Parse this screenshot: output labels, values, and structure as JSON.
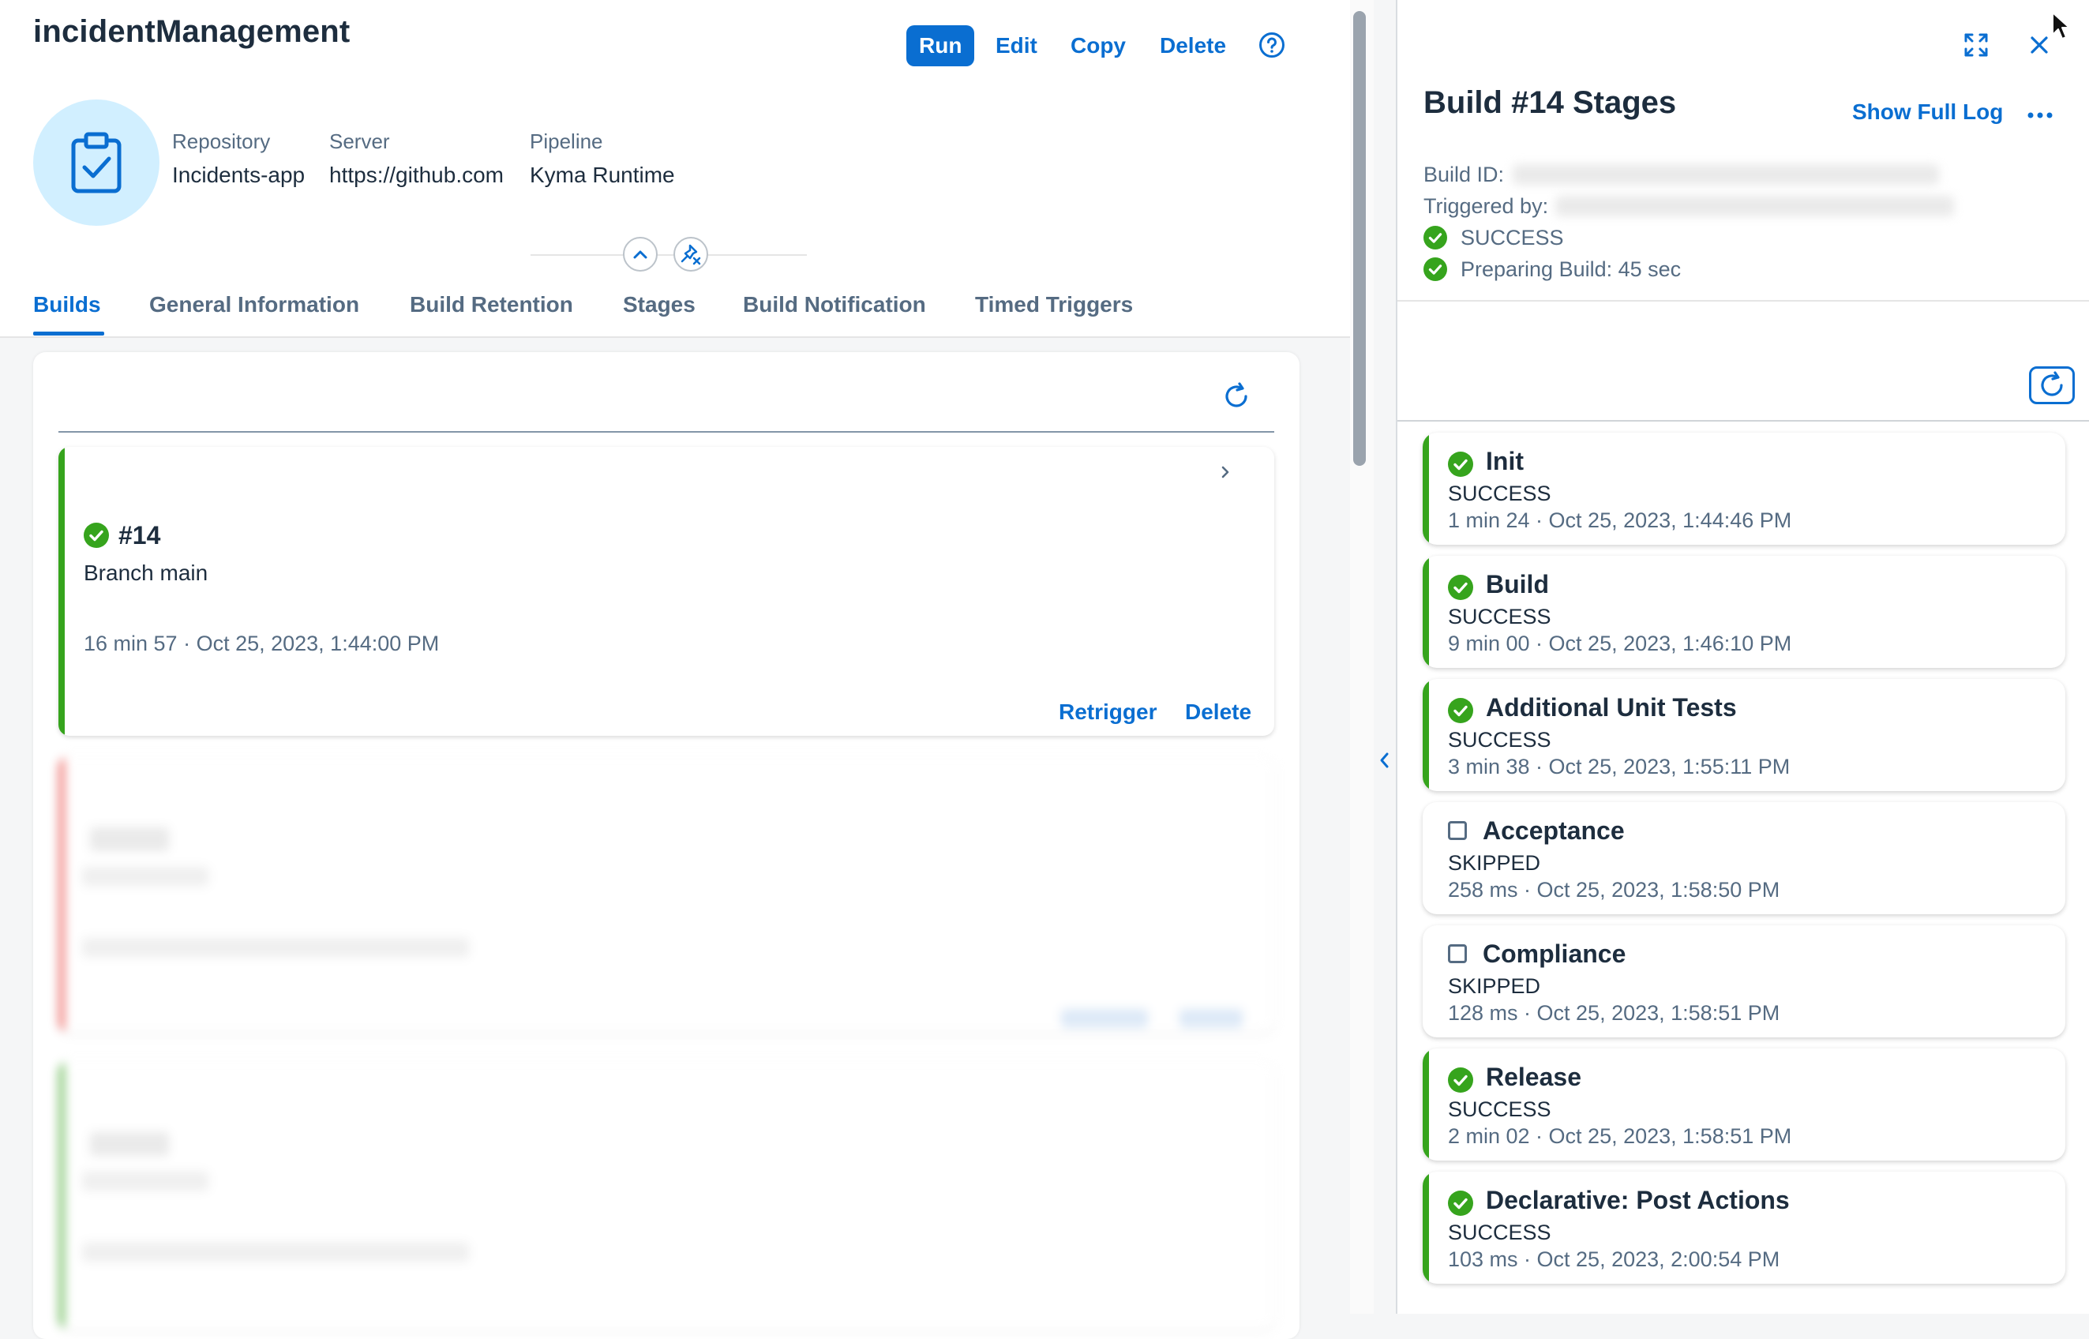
{
  "app": {
    "title": "incidentManagement"
  },
  "header_actions": {
    "run": "Run",
    "edit": "Edit",
    "copy": "Copy",
    "delete": "Delete"
  },
  "meta": {
    "repository_label": "Repository",
    "repository_value": "Incidents-app",
    "server_label": "Server",
    "server_value": "https://github.com",
    "pipeline_label": "Pipeline",
    "pipeline_value": "Kyma Runtime"
  },
  "tabs": [
    "Builds",
    "General Information",
    "Build Retention",
    "Stages",
    "Build Notification",
    "Timed Triggers"
  ],
  "build": {
    "number": "#14",
    "branch": "Branch main",
    "time": "16 min 57 · Oct 25, 2023, 1:44:00 PM",
    "retrigger": "Retrigger",
    "delete": "Delete"
  },
  "panel": {
    "title": "Build #14 Stages",
    "show_full_log": "Show Full Log",
    "build_id_label": "Build ID:",
    "triggered_by_label": "Triggered by:",
    "status": "SUCCESS",
    "preparing": "Preparing Build: 45 sec"
  },
  "stages": [
    {
      "name": "Init",
      "status": "SUCCESS",
      "time": "1 min 24 · Oct 25, 2023, 1:44:46 PM",
      "ok": true
    },
    {
      "name": "Build",
      "status": "SUCCESS",
      "time": "9 min 00 · Oct 25, 2023, 1:46:10 PM",
      "ok": true
    },
    {
      "name": "Additional Unit Tests",
      "status": "SUCCESS",
      "time": "3 min 38 · Oct 25, 2023, 1:55:11 PM",
      "ok": true
    },
    {
      "name": "Acceptance",
      "status": "SKIPPED",
      "time": "258 ms · Oct 25, 2023, 1:58:50 PM",
      "ok": false
    },
    {
      "name": "Compliance",
      "status": "SKIPPED",
      "time": "128 ms · Oct 25, 2023, 1:58:51 PM",
      "ok": false
    },
    {
      "name": "Release",
      "status": "SUCCESS",
      "time": "2 min 02 · Oct 25, 2023, 1:58:51 PM",
      "ok": true
    },
    {
      "name": "Declarative: Post Actions",
      "status": "SUCCESS",
      "time": "103 ms · Oct 25, 2023, 2:00:54 PM",
      "ok": true
    }
  ],
  "colors": {
    "accent": "#0a6ed1",
    "success": "#36a41d",
    "error": "#e9312b"
  },
  "icons": [
    "clipboard-check-icon",
    "help-icon",
    "chevron-up-icon",
    "unpin-icon",
    "refresh-icon",
    "chevron-right-icon",
    "success-check-icon",
    "chevron-left-icon",
    "fullscreen-icon",
    "close-icon",
    "more-icon",
    "checkbox-icon"
  ]
}
